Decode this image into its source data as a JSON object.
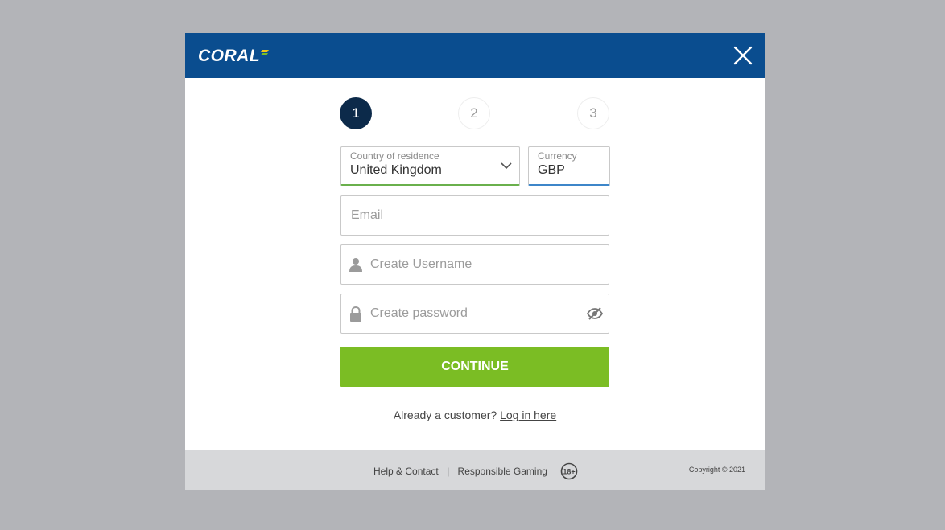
{
  "header": {
    "logo_text": "CORAL",
    "close_icon": "close-icon",
    "header_color": "#0a4d8f"
  },
  "stepper": {
    "steps": [
      "1",
      "2",
      "3"
    ],
    "active_step": 1
  },
  "form": {
    "country": {
      "label": "Country of residence",
      "value": "United Kingdom"
    },
    "currency": {
      "label": "Currency",
      "value": "GBP"
    },
    "email": {
      "placeholder": "Email"
    },
    "username": {
      "placeholder": "Create Username",
      "icon": "user-icon"
    },
    "password": {
      "placeholder": "Create password",
      "icon": "lock-icon",
      "toggle_icon": "eye-off-icon"
    },
    "continue_label": "CONTINUE",
    "continue_color": "#7bbd24"
  },
  "login": {
    "prompt": "Already a customer?",
    "link": "Log in here"
  },
  "footer": {
    "help": "Help & Contact",
    "separator": "|",
    "responsible": "Responsible Gaming",
    "age_badge": "18+",
    "copyright": "Copyright © 2021"
  }
}
